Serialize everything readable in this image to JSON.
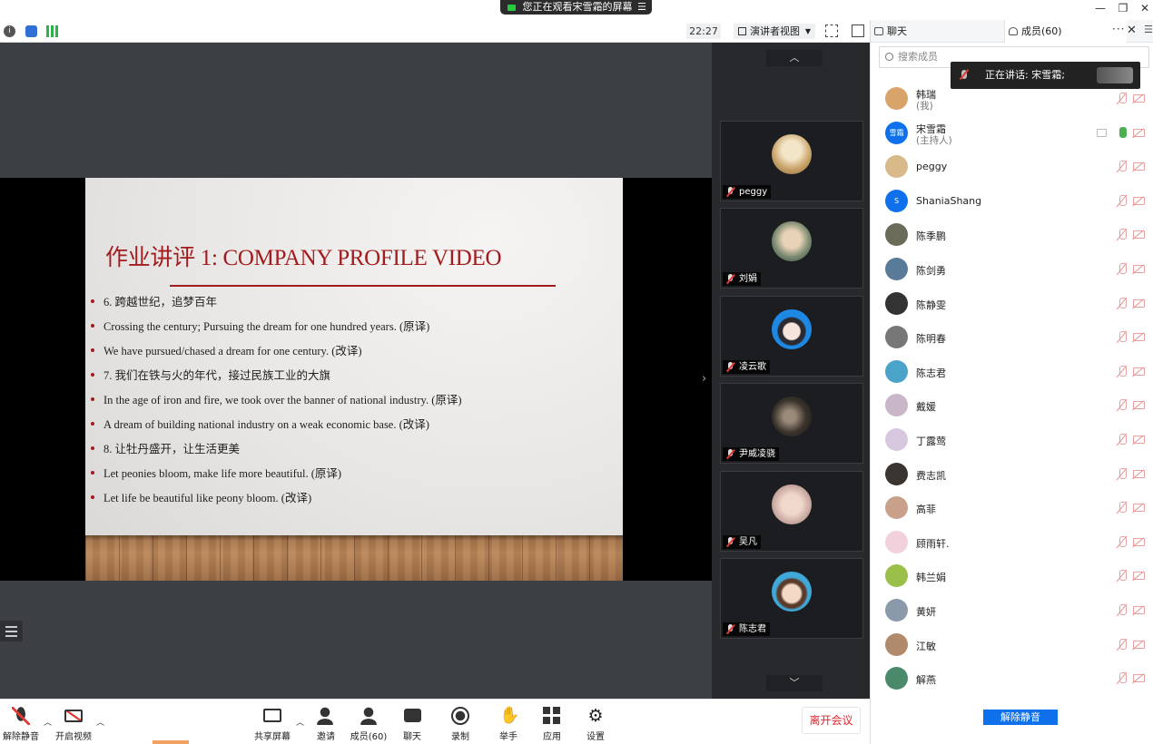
{
  "title_bar": {
    "share_notice": "您正在观看宋雪霜的屏幕",
    "share_menu_icon": "menu-icon",
    "window_controls": [
      "minimize-icon",
      "restore-icon",
      "close-icon"
    ]
  },
  "info_bar": {
    "icons": [
      "info-icon",
      "shield-icon",
      "signal-icon"
    ],
    "clock": "22:27",
    "view_mode": "演讲者视图",
    "fullscreen_icon": "fullscreen-icon",
    "layout_icon": "layout-icon"
  },
  "slide": {
    "title": "作业讲评 1: COMPANY PROFILE VIDEO",
    "bullets": [
      "6. 跨越世纪，追梦百年",
      "Crossing the century; Pursuing the dream for one hundred years. (原译)",
      "We have pursued/chased a dream for one century. (改译)",
      "7. 我们在铁与火的年代，接过民族工业的大旗",
      "In the age of iron and fire, we took over the banner of national industry. (原译)",
      "A dream of building national industry on a weak economic base. (改译)",
      "8. 让牡丹盛开，让生活更美",
      "Let peonies bloom, make life more beautiful. (原译)",
      "Let life be beautiful like peony bloom. (改译)"
    ]
  },
  "video_strip": {
    "tiles": [
      {
        "name": "peggy"
      },
      {
        "name": "刘娟"
      },
      {
        "name": "凌云歌"
      },
      {
        "name": "尹威凌骁"
      },
      {
        "name": "吴凡"
      },
      {
        "name": "陈志君"
      }
    ]
  },
  "toolbar": {
    "unmute": "解除静音",
    "start_video": "开启视频",
    "share_screen": "共享屏幕",
    "invite": "邀请",
    "members": "成员(60)",
    "chat": "聊天",
    "record": "录制",
    "raise_hand": "举手",
    "apps": "应用",
    "settings": "设置",
    "leave": "离开会议"
  },
  "panel": {
    "tab_chat": "聊天",
    "tab_members": "成员(60)",
    "search_placeholder": "搜索成员",
    "speaking_now": "正在讲话: 宋雪霜;",
    "members": [
      {
        "name": "韩瑞",
        "role": "(我)",
        "color": "#d9a46a"
      },
      {
        "name": "宋雪霜",
        "role": "(主持人)",
        "color": "#0e71eb",
        "initial": "雪霜",
        "live": true
      },
      {
        "name": "peggy",
        "role": "",
        "color": "#d8b98a"
      },
      {
        "name": "ShaniaShang",
        "role": "",
        "color": "#0e71eb",
        "initial": "S"
      },
      {
        "name": "陈季鹏",
        "role": "",
        "color": "#6b6b5a"
      },
      {
        "name": "陈剑勇",
        "role": "",
        "color": "#5a7a9a"
      },
      {
        "name": "陈静雯",
        "role": "",
        "color": "#333333"
      },
      {
        "name": "陈明春",
        "role": "",
        "color": "#777777"
      },
      {
        "name": "陈志君",
        "role": "",
        "color": "#4aa3c9"
      },
      {
        "name": "戴媛",
        "role": "",
        "color": "#c9b6c9"
      },
      {
        "name": "丁露莺",
        "role": "",
        "color": "#d7c8e0"
      },
      {
        "name": "费志凯",
        "role": "",
        "color": "#3a3530"
      },
      {
        "name": "高菲",
        "role": "",
        "color": "#c9a08a"
      },
      {
        "name": "顾雨轩.",
        "role": "",
        "color": "#f2d0dc"
      },
      {
        "name": "韩兰娟",
        "role": "",
        "color": "#9ac04a"
      },
      {
        "name": "黄妍",
        "role": "",
        "color": "#8a9aaa"
      },
      {
        "name": "江敏",
        "role": "",
        "color": "#b08a6a"
      },
      {
        "name": "解燕",
        "role": "",
        "color": "#4a8a6a"
      }
    ],
    "unmute_all": "解除静音"
  },
  "colors": {
    "accent_blue": "#0e71eb",
    "slide_title_red": "#a11b1f",
    "leave_red": "#e0262b"
  }
}
